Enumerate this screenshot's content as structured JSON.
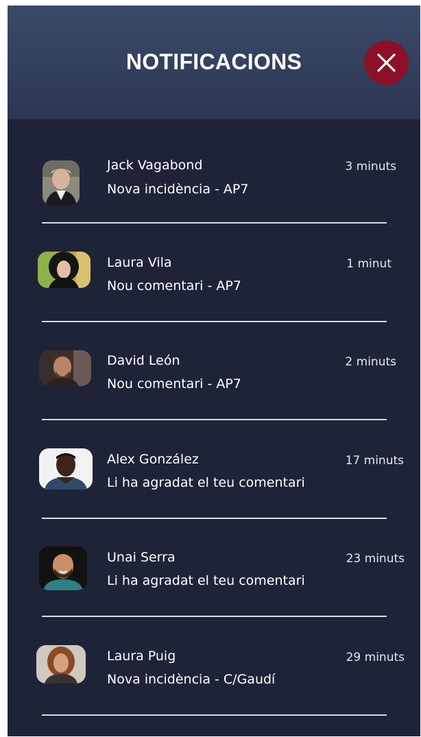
{
  "header": {
    "title": "NOTIFICACIONS",
    "close_icon": "close-icon"
  },
  "colors": {
    "background": "#1f2338",
    "header": "#34415e",
    "close_button": "#8c1029",
    "text": "#ffffff",
    "divider": "#d9dce3"
  },
  "notifications": [
    {
      "name": "Jack Vagabond",
      "subtitle": "Nova incidència - AP7",
      "time": "3 minuts",
      "avatar_icon": "avatar-photo"
    },
    {
      "name": "Laura Vila",
      "subtitle": "Nou comentari - AP7",
      "time": "1 minut",
      "avatar_icon": "avatar-photo"
    },
    {
      "name": "David León",
      "subtitle": "Nou comentari - AP7",
      "time": "2 minuts",
      "avatar_icon": "avatar-photo"
    },
    {
      "name": "Alex González",
      "subtitle": "Li ha agradat el teu comentari",
      "time": "17 minuts",
      "avatar_icon": "avatar-photo"
    },
    {
      "name": "Unai Serra",
      "subtitle": "Li ha agradat el teu comentari",
      "time": "23 minuts",
      "avatar_icon": "avatar-photo"
    },
    {
      "name": "Laura Puig",
      "subtitle": "Nova incidència - C/Gaudí",
      "time": "29 minuts",
      "avatar_icon": "avatar-photo"
    }
  ]
}
